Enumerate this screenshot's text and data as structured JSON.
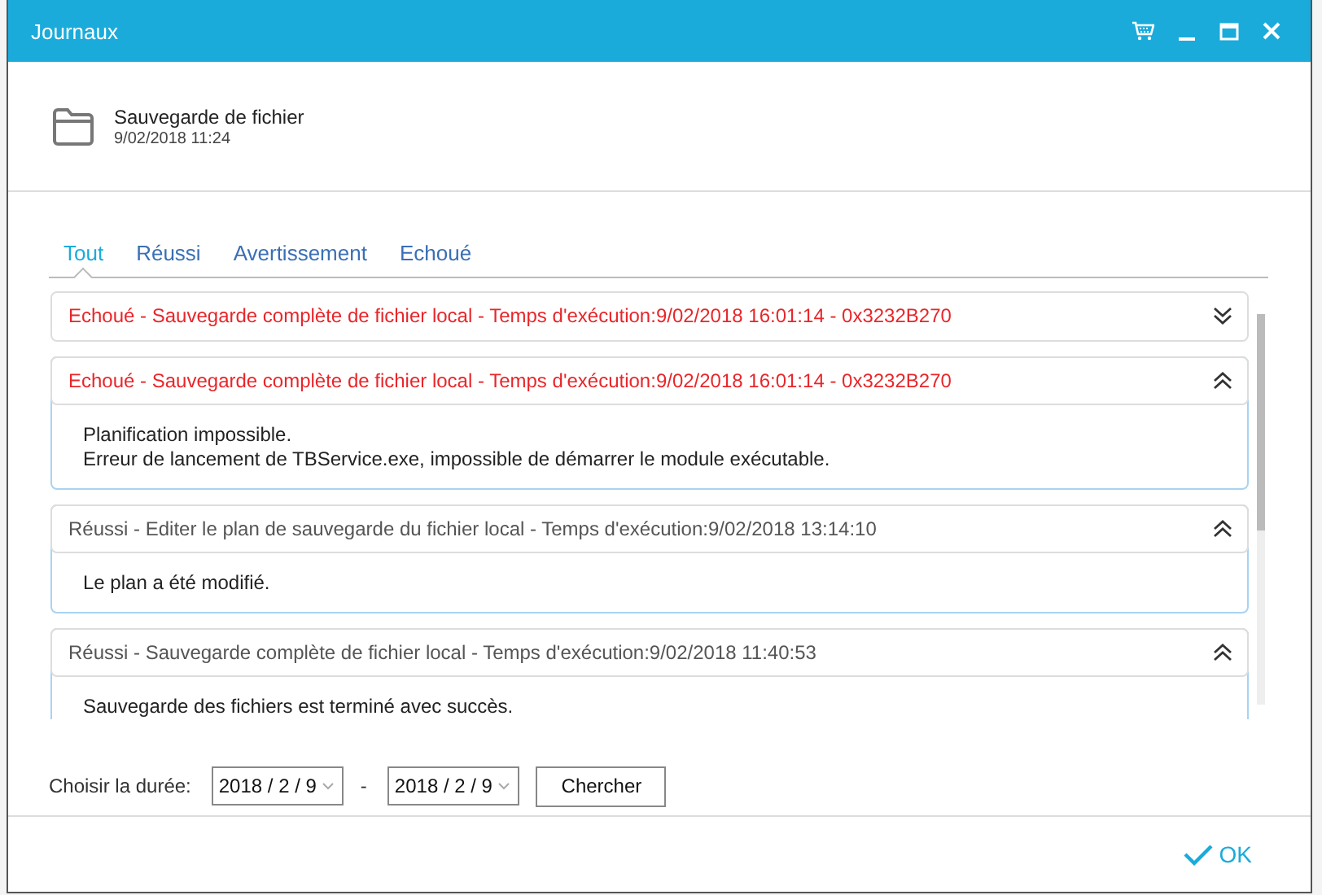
{
  "window": {
    "title": "Journaux"
  },
  "task": {
    "name": "Sauvegarde de fichier",
    "date": "9/02/2018 11:24"
  },
  "tabs": [
    {
      "label": "Tout",
      "selected": true
    },
    {
      "label": "Réussi",
      "selected": false
    },
    {
      "label": "Avertissement",
      "selected": false
    },
    {
      "label": "Echoué",
      "selected": false
    }
  ],
  "entries": [
    {
      "kind": "failed",
      "expanded": false,
      "title": "Echoué - Sauvegarde complète de fichier local - Temps d'exécution:9/02/2018 16:01:14 - 0x3232B270"
    },
    {
      "kind": "failed",
      "expanded": true,
      "title": "Echoué - Sauvegarde complète de fichier local - Temps d'exécution:9/02/2018 16:01:14 - 0x3232B270",
      "details": [
        "Planification impossible.",
        "Erreur de lancement de TBService.exe, impossible de démarrer le module exécutable."
      ]
    },
    {
      "kind": "success",
      "expanded": true,
      "title": "Réussi - Editer le plan de sauvegarde du fichier local - Temps d'exécution:9/02/2018 13:14:10",
      "details": [
        "Le plan a été modifié."
      ]
    },
    {
      "kind": "success",
      "expanded": true,
      "title": "Réussi - Sauvegarde complète de fichier local - Temps d'exécution:9/02/2018 11:40:53",
      "details": [
        "Sauvegarde des fichiers est terminé avec succès."
      ]
    }
  ],
  "filter": {
    "label": "Choisir la durée:",
    "from": "2018 / 2 / 9",
    "separator": "-",
    "to": "2018 / 2 / 9",
    "search_button": "Chercher"
  },
  "ok_button": "OK"
}
